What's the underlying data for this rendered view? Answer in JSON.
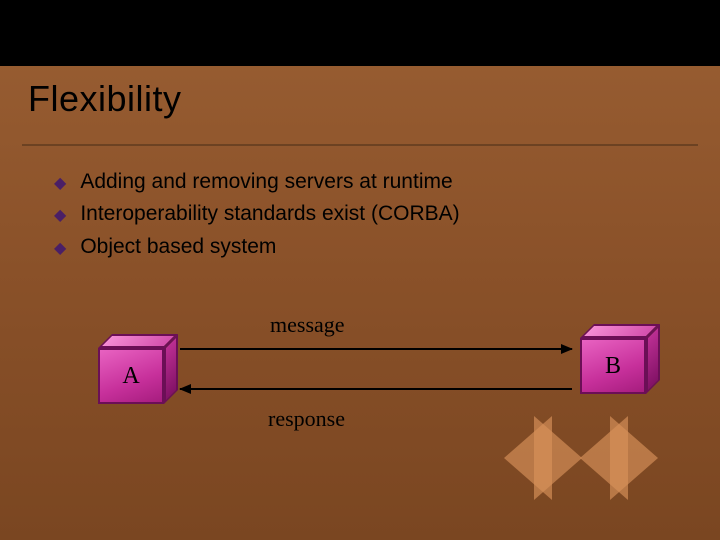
{
  "title": "Flexibility",
  "bullets": [
    "Adding and removing servers at runtime",
    "Interoperability standards exist (CORBA)",
    "Object based system"
  ],
  "diagram": {
    "box_a": "A",
    "box_b": "B",
    "label_top": "message",
    "label_bottom": "response"
  }
}
